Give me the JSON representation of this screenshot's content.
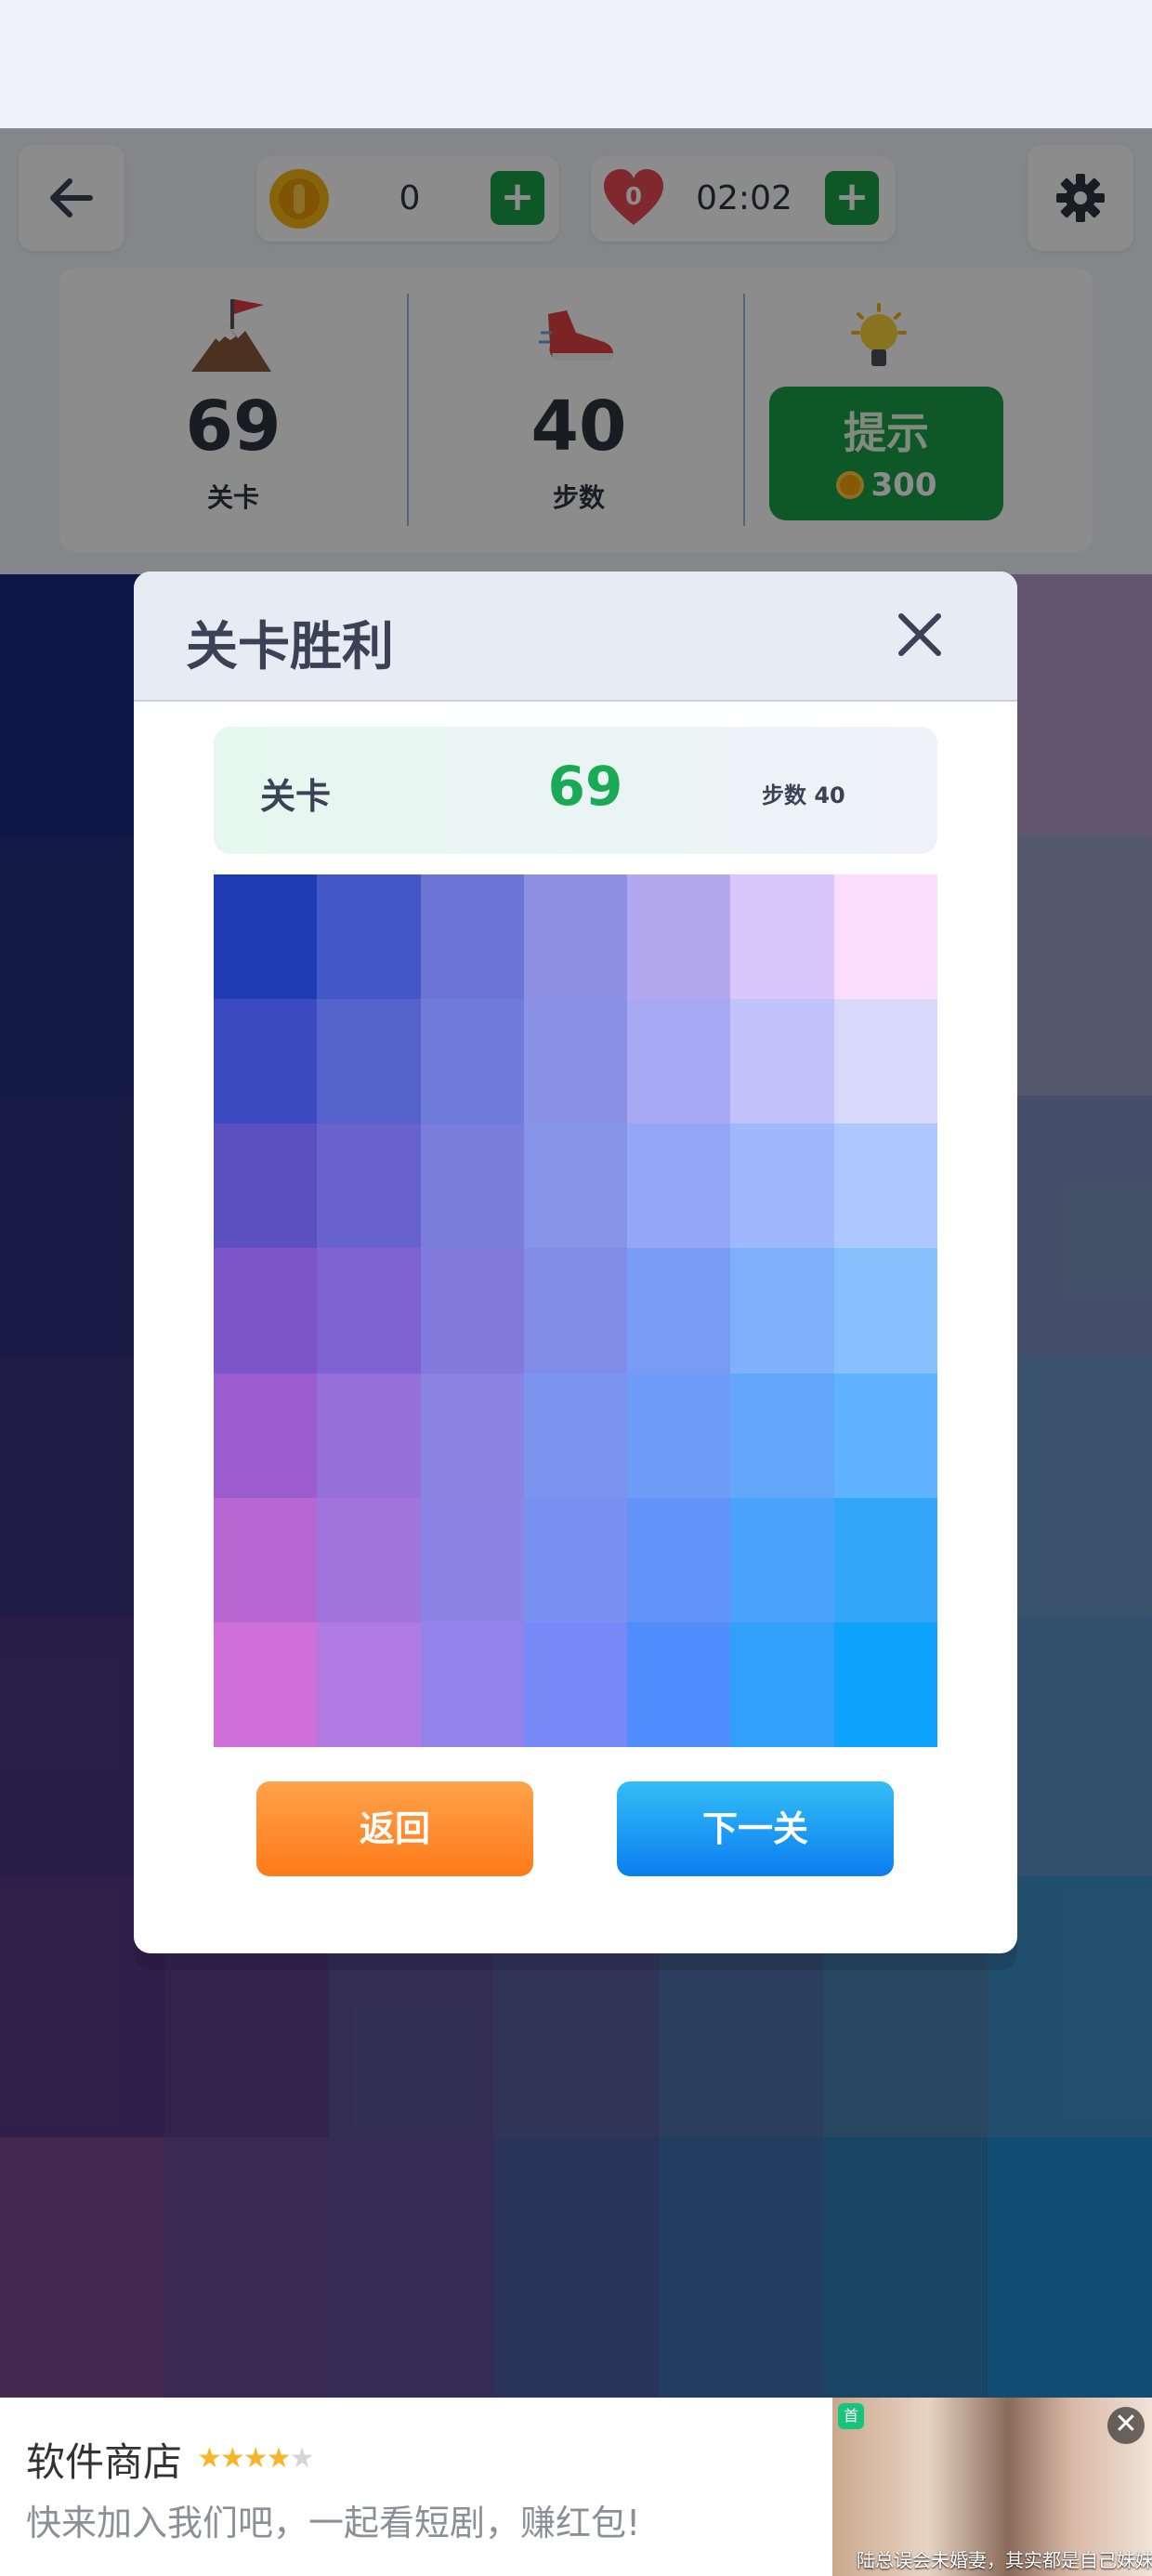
{
  "topbar": {
    "coins": "0",
    "timer": "02:02",
    "lives": "0"
  },
  "stats": {
    "level_value": "69",
    "level_label": "关卡",
    "steps_value": "40",
    "steps_label": "步数",
    "hint_label": "提示",
    "hint_cost": "300"
  },
  "board": {
    "colors": [
      "#1b2a86",
      "#2b2f85",
      "#3a3a88",
      "#523a8a",
      "#6a3a8c",
      "#8a4a8e",
      "#b79bc8",
      "#22307f",
      "#30328a",
      "#3e3f8d",
      "#4f4592",
      "#5e4b97",
      "#6e6a9f",
      "#9aa1c6",
      "#2c327e",
      "#383888",
      "#454592",
      "#4c5597",
      "#5b65a1",
      "#6577a7",
      "#7c8fbe",
      "#3a3282",
      "#45398a",
      "#514393",
      "#5a5299",
      "#5f66a3",
      "#617aad",
      "#6a96c4",
      "#4a3585",
      "#54408d",
      "#5a4d95",
      "#5d5d9d",
      "#5a6fa7",
      "#567fb2",
      "#5b93c6",
      "#5b3887",
      "#5e438e",
      "#5d5397",
      "#58619f",
      "#4f71a9",
      "#4a82b4",
      "#3f8fc9",
      "#7a4a93",
      "#6d4b95",
      "#5f5199",
      "#4e5ea3",
      "#3f6fae",
      "#2f7eb6",
      "#1f8ad2"
    ]
  },
  "modal": {
    "title": "关卡胜利",
    "level_label": "关卡",
    "level_value": "69",
    "steps_text": "步数 40",
    "palette": [
      "#1f3cb5",
      "#4357c8",
      "#6a75d6",
      "#8f8fe3",
      "#b3a8f0",
      "#dac6fa",
      "#fcdcfd",
      "#3b4ac0",
      "#5663cc",
      "#6e7bd8",
      "#8a92e6",
      "#a6a8f3",
      "#c1c2fa",
      "#d7d8fa",
      "#5c4fc0",
      "#6862cc",
      "#7a7dda",
      "#8795e8",
      "#94a6f6",
      "#9fb8fd",
      "#adc8fe",
      "#7c56c8",
      "#8063d2",
      "#8179dc",
      "#7f8de8",
      "#7a9bf5",
      "#80b0fc",
      "#87c0fe",
      "#9b5ccf",
      "#9470d8",
      "#8a83e2",
      "#7d94ee",
      "#6f9cf8",
      "#62a7fc",
      "#5fb2fd",
      "#b766d3",
      "#a174dc",
      "#8c84e4",
      "#7890f0",
      "#6293f9",
      "#4aa2fb",
      "#33a6fa",
      "#d16fd8",
      "#b07ae2",
      "#9382ea",
      "#7689f6",
      "#4e8dfb",
      "#30a0fa",
      "#0da2fb"
    ],
    "back_label": "返回",
    "next_label": "下一关"
  },
  "ad": {
    "title": "软件商店",
    "rating_stars": "★★★★★",
    "description": "快来加入我们吧，一起看短剧，赚红包!",
    "badge": "首",
    "close": "✕",
    "caption": "陆总误会未婚妻，其实都是自己妹妹.告"
  },
  "icons": {
    "back": "arrow-left-icon",
    "settings": "gear-icon",
    "coin": "coin-icon",
    "heart": "heart-icon",
    "flag": "mountain-flag-icon",
    "shoe": "sneaker-icon",
    "bulb": "lightbulb-icon",
    "close": "close-icon"
  }
}
